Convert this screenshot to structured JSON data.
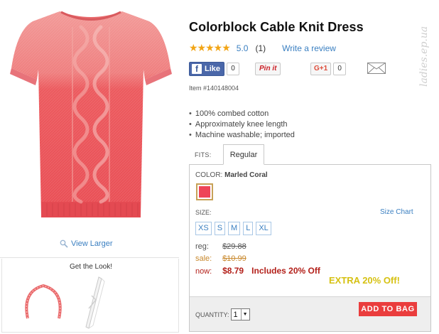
{
  "product": {
    "title": "Colorblock Cable Knit Dress",
    "rating_stars": "★★★★★",
    "rating_value": "5.0",
    "rating_count": "(1)",
    "write_review": "Write a review",
    "item_number": "Item #140148004",
    "features": [
      "100% combed cotton",
      "Approximately knee length",
      "Machine washable; imported"
    ]
  },
  "social": {
    "fb_label": "Like",
    "fb_count": "0",
    "pin_label": "Pin it",
    "gplus_label": "G+1",
    "gplus_count": "0",
    "mail_icon": "envelope-icon"
  },
  "gallery": {
    "view_larger": "View Larger",
    "get_the_look": "Get the Look!"
  },
  "fit": {
    "label": "FITS:",
    "selected": "Regular"
  },
  "options": {
    "color_label": "COLOR:",
    "color_name": "Marled Coral",
    "swatch_color": "#ee4558",
    "size_label": "SIZE:",
    "size_chart": "Size Chart",
    "sizes": [
      "XS",
      "S",
      "M",
      "L",
      "XL"
    ]
  },
  "pricing": {
    "reg_label": "reg:",
    "reg_price": "$29.88",
    "sale_label": "sale:",
    "sale_price": "$10.99",
    "now_label": "now:",
    "now_price": "$8.79",
    "now_note": "Includes 20% Off",
    "extra": "EXTRA 20% Off!"
  },
  "cart": {
    "quantity_label": "QUANTITY:",
    "quantity_value": "1",
    "add_to_bag": "ADD TO BAG"
  },
  "watermark": "ladies.ep.ua"
}
